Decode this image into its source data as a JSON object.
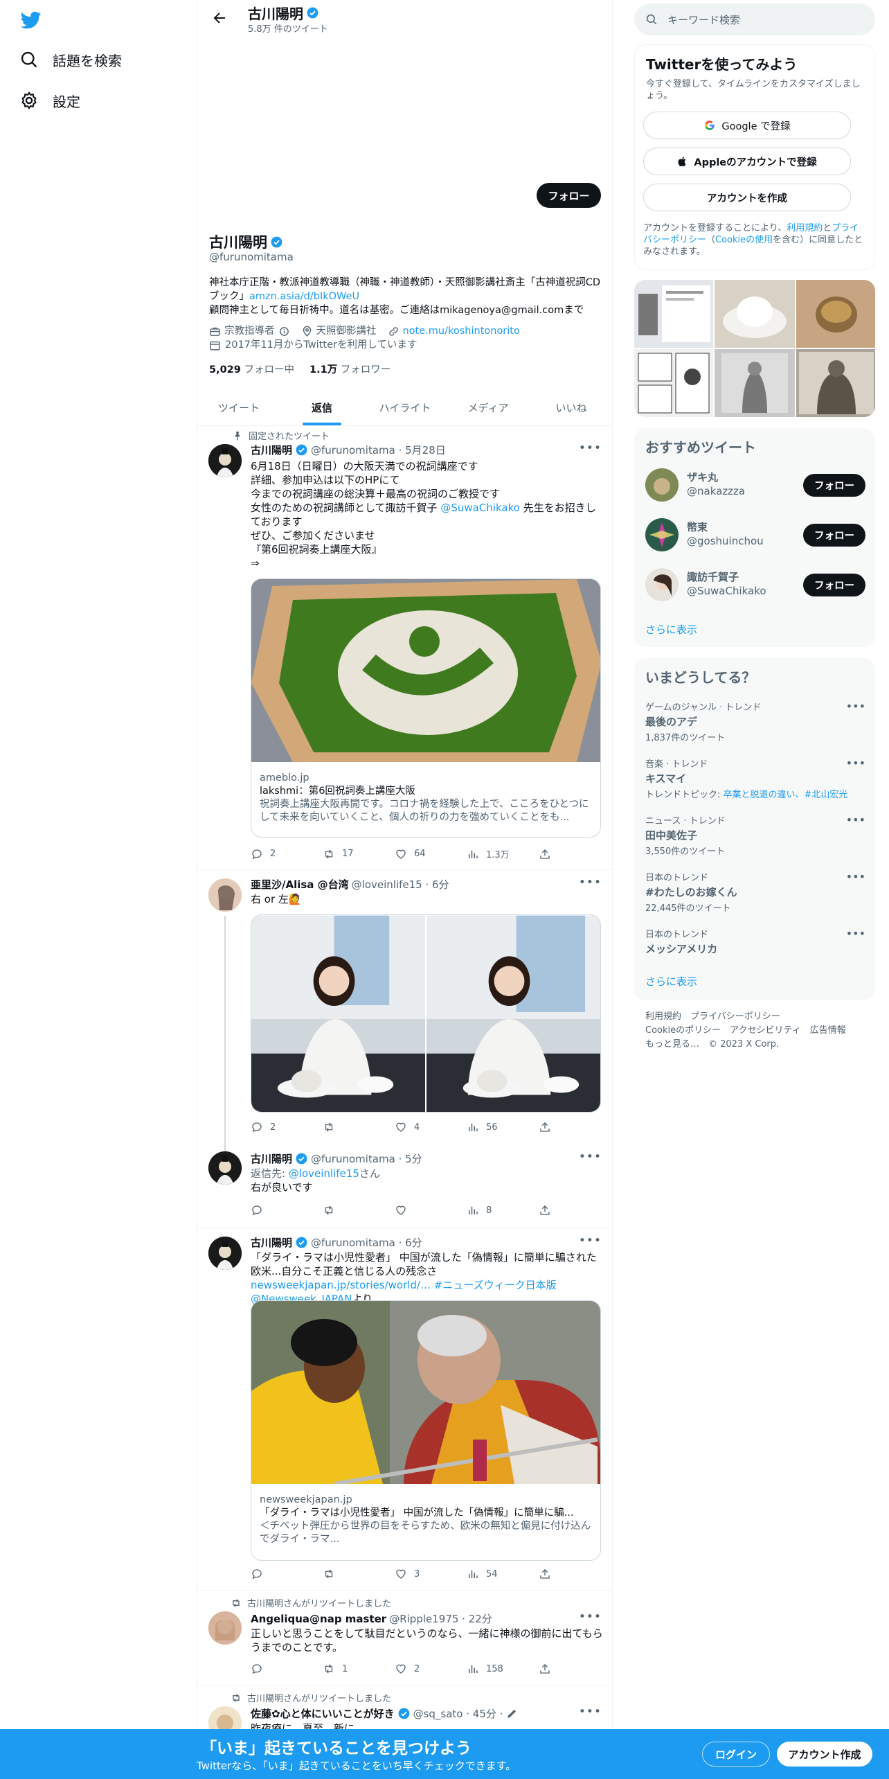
{
  "nav": {
    "explore": "話題を検索",
    "settings": "設定"
  },
  "header": {
    "name": "古川陽明",
    "tweet_count": "5.8万 件のツイート"
  },
  "profile": {
    "follow": "フォロー",
    "name": "古川陽明",
    "handle": "@furunomitama",
    "bio_line1": "神社本庁正階・教派神道教導職（神職・神道教師）・天照御影講社斎主「古神道祝詞CDブック」",
    "bio_link": "amzn.asia/d/bIkOWeU",
    "bio_line2": "顧問神主として毎日祈祷中。道名は基密。ご連絡はmikagenoya@gmail.comまで",
    "category": "宗教指導者",
    "location": "天照御影講社",
    "website": "note.mu/koshintonorito",
    "joined": "2017年11月からTwitterを利用しています",
    "following_count": "5,029",
    "following_label": "フォロー中",
    "followers_count": "1.1万",
    "followers_label": "フォロワー"
  },
  "tabs": [
    "ツイート",
    "返信",
    "ハイライト",
    "メディア",
    "いいね"
  ],
  "tweets": {
    "t1": {
      "pinned": "固定されたツイート",
      "name": "古川陽明",
      "meta": "@furunomitama · 5月28日",
      "line1": "6月18日（日曜日）の大阪天満での祝詞講座です",
      "line2": "詳細、参加申込は以下のHPにて",
      "line3": "今までの祝詞講座の総決算＋最高の祝詞のご教授です",
      "line4a": "女性のための祝詞講師として諏訪千賀子 ",
      "line4_mention": "@SuwaChikako",
      "line4b": " 先生をお招きしております",
      "line5": "ぜひ、ご参加くださいませ",
      "line6": "『第6回祝詞奏上講座大阪』",
      "line7": "⇒",
      "card_domain": "ameblo.jp",
      "card_title": "lakshmi：第6回祝詞奏上講座大阪",
      "card_desc": "祝詞奏上講座大阪再開です。コロナ禍を経験した上で、こころをひとつにして未来を向いていくこと、個人の祈りの力を強めていくことをも...",
      "replies": "2",
      "retweets": "17",
      "likes": "64",
      "views": "1.3万"
    },
    "t2": {
      "name": "亜里沙/Alisa @台湾",
      "meta": "@loveinlife15 · 6分",
      "text": "右 or 左🙋",
      "replies": "2",
      "retweets": "",
      "likes": "4",
      "views": "56"
    },
    "t3": {
      "name": "古川陽明",
      "meta": "@furunomitama · 5分",
      "reply_to_label": "返信先: ",
      "reply_to": "@loveinlife15",
      "reply_to_suffix": "さん",
      "text": "右が良いです",
      "views": "8"
    },
    "t4": {
      "name": "古川陽明",
      "meta": "@furunomitama · 6分",
      "text1": "「ダライ・ラマは小児性愛者」 中国が流した「偽情報」に簡単に騙された欧米...自分こそ正義と信じる人の残念さ ",
      "link": "newsweekjapan.jp/stories/world/…",
      "hashtag": " #ニューズウィーク日本版",
      "mention": " @Newsweek_JAPAN",
      "suffix": "より",
      "card_domain": "newsweekjapan.jp",
      "card_title": "「ダライ・ラマは小児性愛者」 中国が流した「偽情報」に簡単に騙...",
      "card_desc": "＜チベット弾圧から世界の目をそらすため、欧米の無知と偏見に付け込んでダライ・ラマ...",
      "replies": "",
      "retweets": "",
      "likes": "3",
      "views": "54"
    },
    "t5": {
      "rt_label": "古川陽明さんがリツイートしました",
      "name": "Angeliqua@nap master",
      "meta": "@Ripple1975 · 22分",
      "text": "正しいと思うことをして駄目だというのなら、一緒に神様の御前に出てもらうまでのことです。",
      "replies": "",
      "retweets": "1",
      "likes": "2",
      "views": "158"
    },
    "t6": {
      "rt_label": "古川陽明さんがリツイートしました",
      "name": "佐藤✿心と体にいいことが好き",
      "meta": "@sq_sato · 45分 ·",
      "text": "昨夜療に…夏至…新に"
    }
  },
  "right": {
    "search_placeholder": "キーワード検索",
    "signup_title": "Twitterを使ってみよう",
    "signup_sub": "今すぐ登録して、タイムラインをカスタマイズしましょう。",
    "google_btn": "Google で登録",
    "apple_btn": "Appleのアカウントで登録",
    "create_btn": "アカウントを作成",
    "terms1": "アカウントを登録することにより、",
    "terms_link1": "利用規約",
    "terms2": "と",
    "terms_link2": "プライバシーポリシー",
    "terms3": "（",
    "terms_link3": "Cookieの使用",
    "terms4": "を含む）に同意したとみなされます。",
    "rec_title": "おすすめツイート",
    "recs": [
      {
        "name": "ザキ丸",
        "handle": "@nakazzza",
        "btn": "フォロー"
      },
      {
        "name": "幣束",
        "handle": "@goshuinchou",
        "btn": "フォロー"
      },
      {
        "name": "諏訪千賀子",
        "handle": "@SuwaChikako",
        "btn": "フォロー"
      }
    ],
    "show_more": "さらに表示",
    "trends_title": "いまどうしてる？",
    "trends": [
      {
        "cat": "ゲームのジャンル · トレンド",
        "name": "最後のアデ",
        "count": "1,837件のツイート"
      },
      {
        "cat": "音楽 · トレンド",
        "name": "キスマイ",
        "count_prefix": "トレンドトピック: ",
        "count_link": "卒業と脱退の違い、#北山宏光"
      },
      {
        "cat": "ニュース · トレンド",
        "name": "田中美佐子",
        "count": "3,550件のツイート"
      },
      {
        "cat": "日本のトレンド",
        "name": "#わたしのお嫁くん",
        "count": "22,445件のツイート"
      },
      {
        "cat": "日本のトレンド",
        "name": "メッシアメリカ",
        "count": ""
      }
    ],
    "show_more2": "さらに表示",
    "footer_line1": "利用規約　プライバシーポリシー",
    "footer_line2": "Cookieのポリシー　アクセシビリティ　広告情報",
    "footer_line3": "もっと見る…　© 2023 X Corp."
  },
  "banner": {
    "title": "「いま」起きていることを見つけよう",
    "sub": "Twitterなら、「いま」起きていることをいち早くチェックできます。",
    "login": "ログイン",
    "signup": "アカウント作成"
  },
  "colors": {
    "accent": "#1d9bf0",
    "text": "#0f1419",
    "secondary": "#536471"
  }
}
